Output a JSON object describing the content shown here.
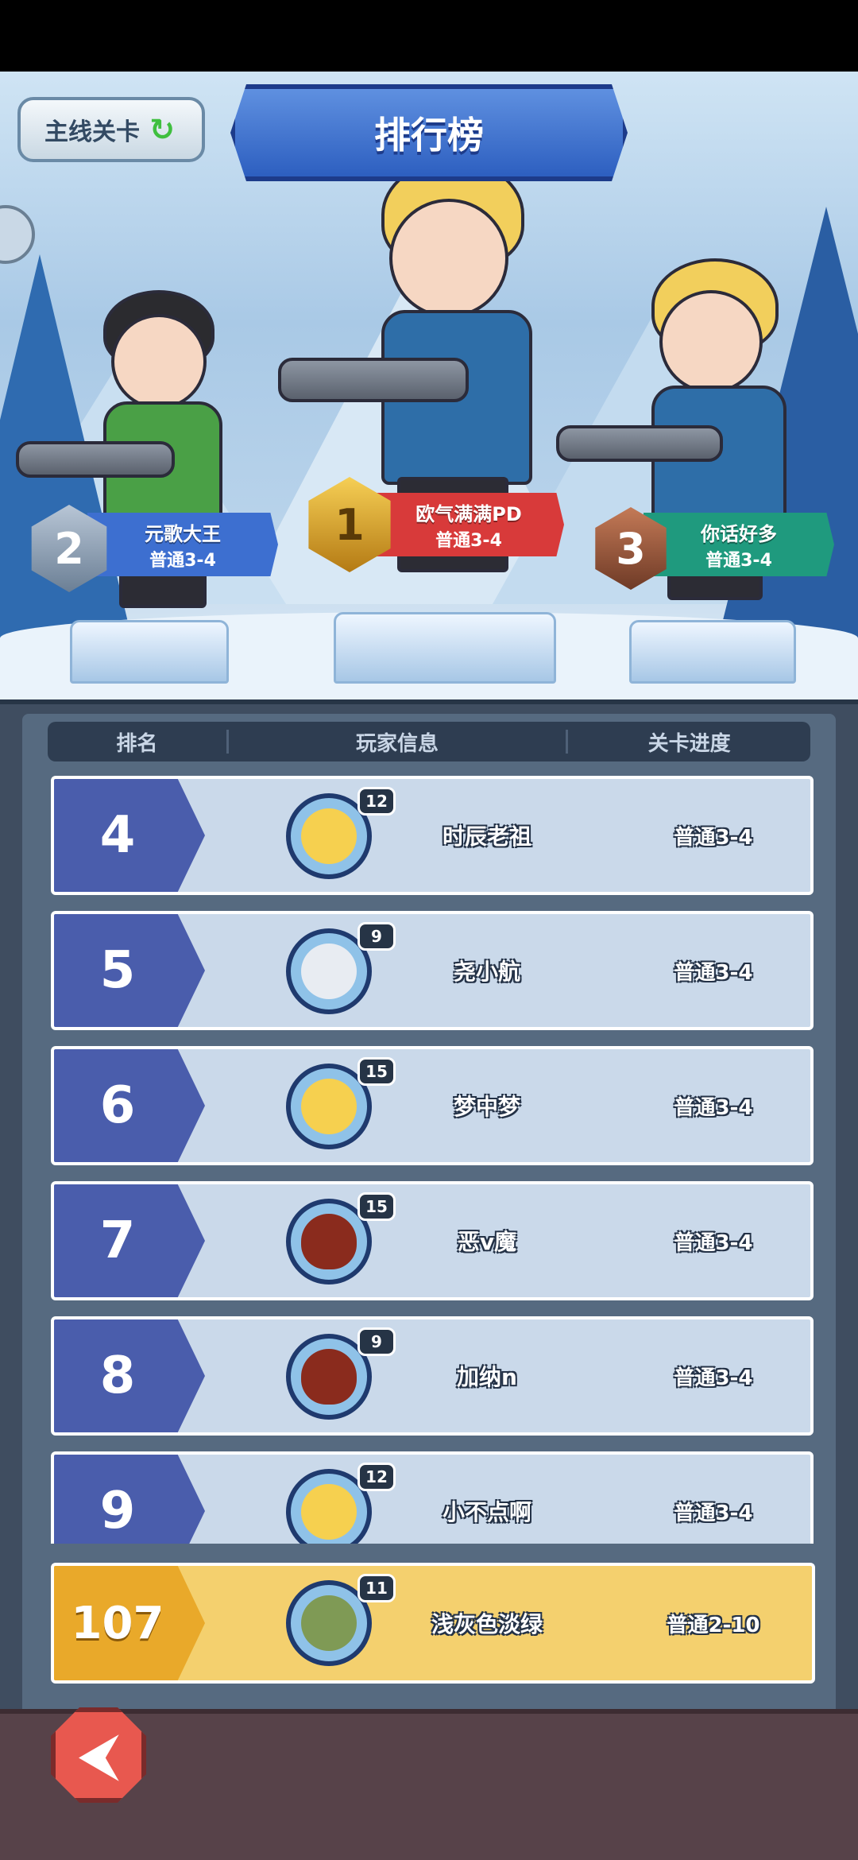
{
  "header": {
    "main_stage_button": "主线关卡",
    "refresh_icon": "refresh-icon",
    "title": "排行榜"
  },
  "podium": [
    {
      "rank": "2",
      "name": "元歌大王",
      "level": "普通3-4",
      "color": "#3d6fd0"
    },
    {
      "rank": "1",
      "name": "欧气满满PD",
      "level": "普通3-4",
      "color": "#d83a3a"
    },
    {
      "rank": "3",
      "name": "你话好多",
      "level": "普通3-4",
      "color": "#1f9a7e"
    }
  ],
  "table": {
    "headers": [
      "排名",
      "玩家信息",
      "关卡进度"
    ]
  },
  "rows": [
    {
      "rank": "4",
      "avatar_level": "12",
      "name": "时辰老祖",
      "progress": "普通3-4",
      "avatar": "blonde-hero-icon"
    },
    {
      "rank": "5",
      "avatar_level": "9",
      "name": "尧小航",
      "progress": "普通3-4",
      "avatar": "old-wizard-icon"
    },
    {
      "rank": "6",
      "avatar_level": "15",
      "name": "梦中梦",
      "progress": "普通3-4",
      "avatar": "blonde-hero-icon"
    },
    {
      "rank": "7",
      "avatar_level": "15",
      "name": "恶v魔",
      "progress": "普通3-4",
      "avatar": "lava-egg-icon"
    },
    {
      "rank": "8",
      "avatar_level": "9",
      "name": "加纳n",
      "progress": "普通3-4",
      "avatar": "lava-egg-icon"
    },
    {
      "rank": "9",
      "avatar_level": "12",
      "name": "小不点啊",
      "progress": "普通3-4",
      "avatar": "blonde-hero-icon"
    }
  ],
  "me": {
    "rank": "107",
    "avatar_level": "11",
    "name": "浅灰色淡绿",
    "progress": "普通2-10",
    "avatar": "lizard-monster-icon"
  },
  "footer": {
    "back_icon": "back-arrow-icon",
    "back_glyph": "⮜"
  }
}
